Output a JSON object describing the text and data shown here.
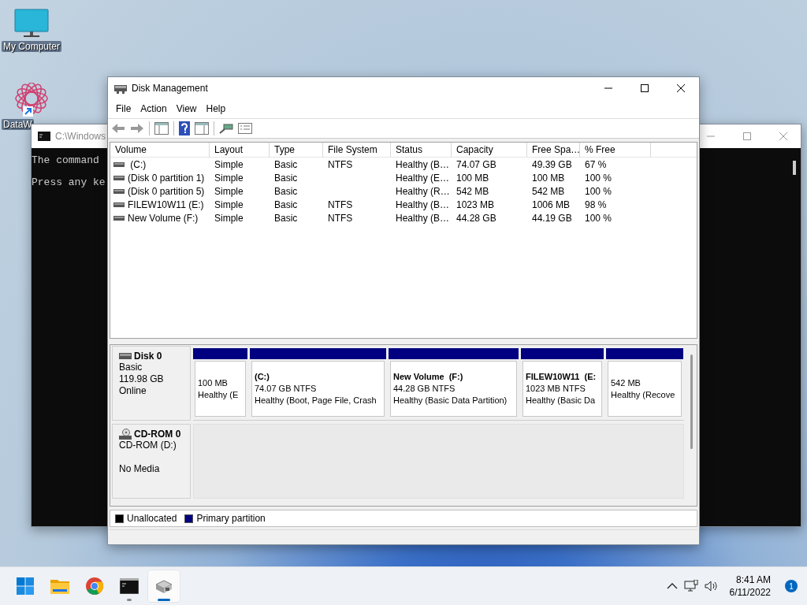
{
  "desktop_icons": [
    {
      "kind": "computer",
      "label": "My Computer"
    },
    {
      "kind": "shortcut",
      "label": "DataW"
    }
  ],
  "console_window": {
    "title": "C:\\Windows",
    "lines": [
      "The command",
      "Press any ke"
    ]
  },
  "disk_window": {
    "title": "Disk Management",
    "menu": [
      "File",
      "Action",
      "View",
      "Help"
    ],
    "columns": [
      "Volume",
      "Layout",
      "Type",
      "File System",
      "Status",
      "Capacity",
      "Free Spa…",
      "% Free"
    ],
    "rows": [
      {
        "cells": [
          " (C:)",
          "Simple",
          "Basic",
          "NTFS",
          "Healthy (B…",
          "74.07 GB",
          "49.39 GB",
          "67 %"
        ]
      },
      {
        "cells": [
          "(Disk 0 partition 1)",
          "Simple",
          "Basic",
          "",
          "Healthy (E…",
          "100 MB",
          "100 MB",
          "100 %"
        ]
      },
      {
        "cells": [
          "(Disk 0 partition 5)",
          "Simple",
          "Basic",
          "",
          "Healthy (R…",
          "542 MB",
          "542 MB",
          "100 %"
        ]
      },
      {
        "cells": [
          "FILEW10W11 (E:)",
          "Simple",
          "Basic",
          "NTFS",
          "Healthy (B…",
          "1023 MB",
          "1006 MB",
          "98 %"
        ]
      },
      {
        "cells": [
          "New Volume (F:)",
          "Simple",
          "Basic",
          "NTFS",
          "Healthy (B…",
          "44.28 GB",
          "44.19 GB",
          "100 %"
        ]
      }
    ],
    "disks": [
      {
        "kind": "disk",
        "name": "Disk 0",
        "lines": [
          "Basic",
          "119.98 GB",
          "Online"
        ],
        "partitions": [
          {
            "kind": "primary",
            "lines": [
              "100 MB",
              "Healthy (E"
            ]
          },
          {
            "kind": "primary",
            "title": "(C:)",
            "lines": [
              "74.07 GB NTFS",
              "Healthy (Boot, Page File, Crash"
            ]
          },
          {
            "kind": "primary",
            "title": "New Volume  (F:)",
            "lines": [
              "44.28 GB NTFS",
              "Healthy (Basic Data Partition)"
            ]
          },
          {
            "kind": "primary",
            "title": "FILEW10W11  (E:",
            "lines": [
              "1023 MB NTFS",
              "Healthy (Basic Da"
            ]
          },
          {
            "kind": "primary",
            "lines": [
              "542 MB",
              "Healthy (Recove"
            ]
          }
        ]
      },
      {
        "kind": "cdrom",
        "name": "CD-ROM 0",
        "lines": [
          "CD-ROM (D:)",
          "No Media"
        ]
      }
    ],
    "legend": [
      {
        "label": "Unallocated",
        "color": "#000000"
      },
      {
        "label": "Primary partition",
        "color": "#000080"
      }
    ]
  },
  "taskbar": {
    "apps": [
      {
        "kind": "start",
        "selected": false,
        "running": false
      },
      {
        "kind": "folder",
        "selected": false,
        "running": false
      },
      {
        "kind": "browser",
        "selected": false,
        "running": false
      },
      {
        "kind": "console",
        "selected": false,
        "running": true
      },
      {
        "kind": "disk",
        "selected": true,
        "running": true
      }
    ],
    "time": "8:41 AM",
    "date": "6/11/2022",
    "notifications": "1"
  }
}
